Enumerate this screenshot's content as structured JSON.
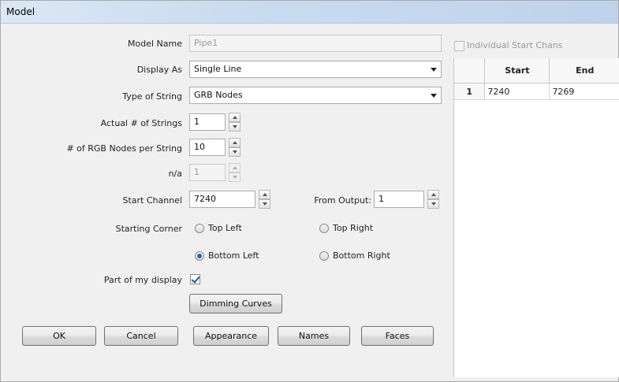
{
  "window": {
    "title": "Model"
  },
  "form": {
    "model_name": {
      "label": "Model Name",
      "value": "Pipe1"
    },
    "display_as": {
      "label": "Display As",
      "value": "Single Line"
    },
    "type_of_string": {
      "label": "Type of String",
      "value": "GRB Nodes"
    },
    "actual_strings": {
      "label": "Actual # of Strings",
      "value": "1"
    },
    "nodes_per_string": {
      "label": "# of RGB Nodes per String",
      "value": "10"
    },
    "na": {
      "label": "n/a",
      "value": "1"
    },
    "start_channel": {
      "label": "Start Channel",
      "value": "7240"
    },
    "from_output": {
      "label": "From Output:",
      "value": "1"
    },
    "starting_corner": {
      "label": "Starting Corner",
      "options": [
        "Top Left",
        "Top Right",
        "Bottom Left",
        "Bottom Right"
      ],
      "selected": "Bottom Left"
    },
    "part_of_display": {
      "label": "Part of my display",
      "checked": true
    },
    "dimming_curves_label": "Dimming Curves"
  },
  "individual_start_chans": {
    "label": "Individual Start Chans",
    "checked": false
  },
  "channel_grid": {
    "columns": [
      "Start",
      "End"
    ],
    "rows": [
      {
        "index": "1",
        "start": "7240",
        "end": "7269"
      }
    ]
  },
  "buttons": {
    "ok": "OK",
    "cancel": "Cancel",
    "appearance": "Appearance",
    "names": "Names",
    "faces": "Faces"
  }
}
